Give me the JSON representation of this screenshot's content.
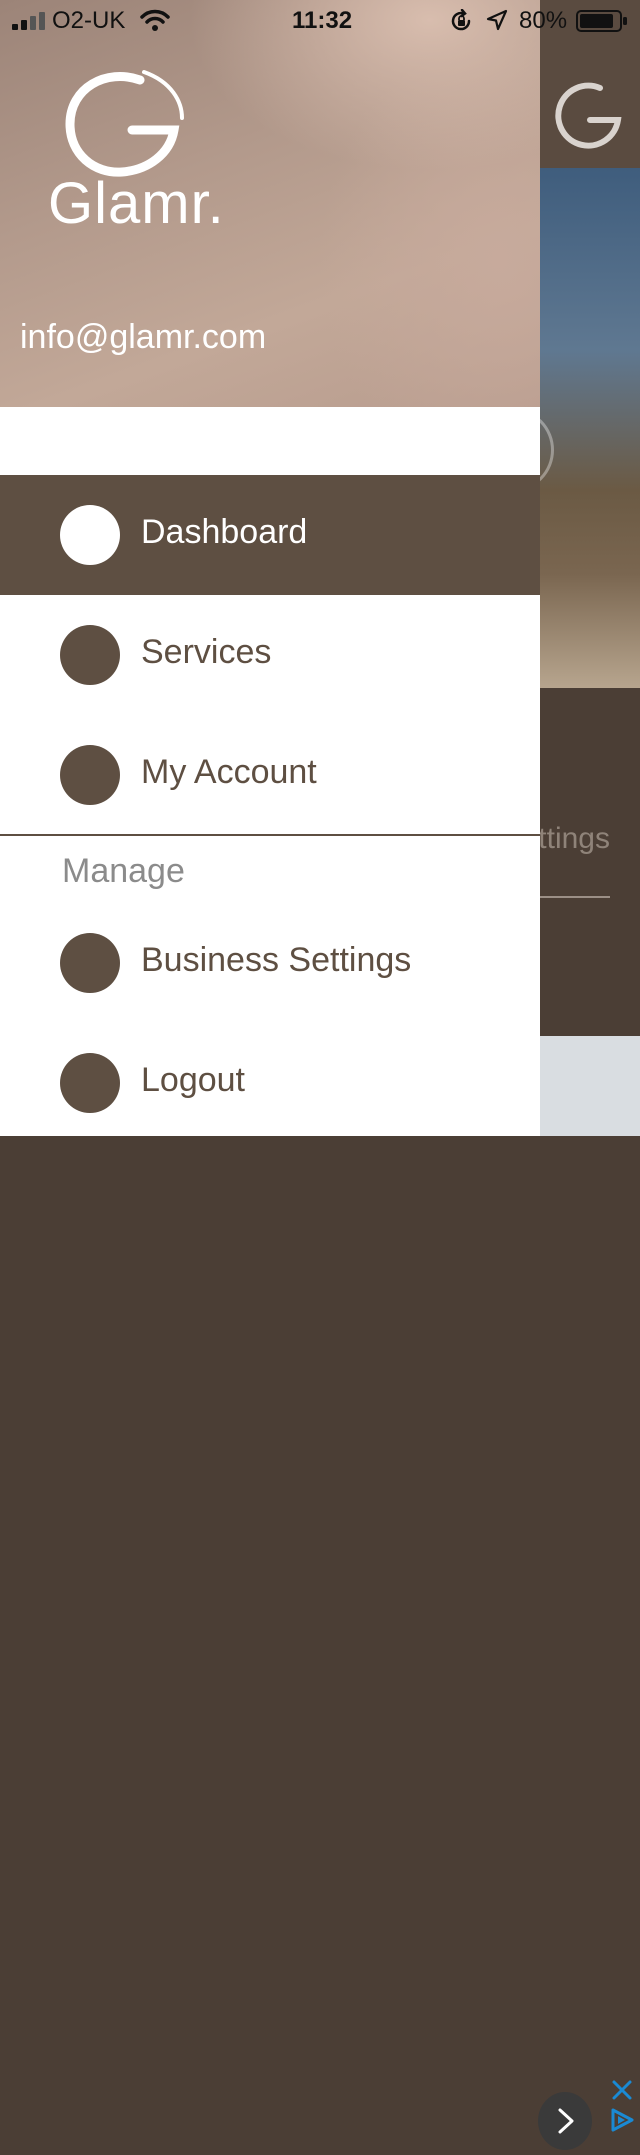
{
  "status_bar": {
    "carrier": "O2-UK",
    "time": "11:32",
    "battery": "80%"
  },
  "drawer": {
    "brand": "Glamr.",
    "email": "info@glamr.com",
    "menu": [
      {
        "label": "Dashboard",
        "active": true
      },
      {
        "label": "Services",
        "active": false
      },
      {
        "label": "My Account",
        "active": false
      }
    ],
    "section_title": "Manage",
    "manage_items": [
      {
        "label": "Business Settings"
      },
      {
        "label": "Logout"
      }
    ]
  },
  "background_app": {
    "settings_fragment": "ttings"
  },
  "colors": {
    "primary": "#5e4f42",
    "drawer_bg": "#ffffff",
    "section_text": "#8b8b8b"
  }
}
